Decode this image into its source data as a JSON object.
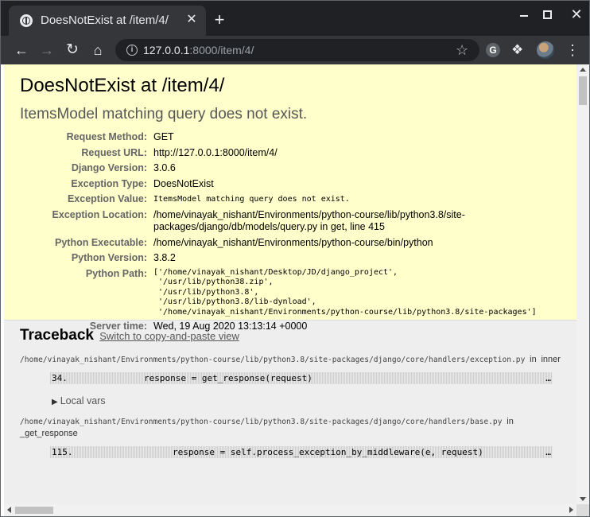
{
  "browser": {
    "tab_title": "DoesNotExist at /item/4/",
    "tab_close": "✕",
    "new_tab": "+",
    "url_host": "127.0.0.1",
    "url_path": ":8000/item/4/",
    "extension_g": "G",
    "icons": {
      "back": "arrow-left-icon",
      "forward": "arrow-right-icon",
      "reload": "reload-icon",
      "home": "home-icon",
      "star": "star-icon",
      "menu": "kebab-menu-icon"
    }
  },
  "error": {
    "title": "DoesNotExist at /item/4/",
    "exception_value": "ItemsModel matching query does not exist."
  },
  "meta": [
    {
      "label": "Request Method:",
      "value": "GET"
    },
    {
      "label": "Request URL:",
      "value": "http://127.0.0.1:8000/item/4/"
    },
    {
      "label": "Django Version:",
      "value": "3.0.6"
    },
    {
      "label": "Exception Type:",
      "value": "DoesNotExist"
    },
    {
      "label": "Exception Value:",
      "value": "ItemsModel matching query does not exist."
    },
    {
      "label": "Exception Location:",
      "value": "/home/vinayak_nishant/Environments/python-course/lib/python3.8/site-packages/django/db/models/query.py in get, line 415"
    },
    {
      "label": "Python Executable:",
      "value": "/home/vinayak_nishant/Environments/python-course/bin/python"
    },
    {
      "label": "Python Version:",
      "value": "3.8.2"
    },
    {
      "label": "Python Path:",
      "value": "['/home/vinayak_nishant/Desktop/JD/django_project',\n '/usr/lib/python38.zip',\n '/usr/lib/python3.8',\n '/usr/lib/python3.8/lib-dynload',\n '/home/vinayak_nishant/Environments/python-course/lib/python3.8/site-packages']"
    },
    {
      "label": "Server time:",
      "value": "Wed, 19 Aug 2020 13:13:14 +0000"
    }
  ],
  "traceback": {
    "heading": "Traceback",
    "switch_link": "Switch to copy-and-paste view",
    "frames": [
      {
        "file": "/home/vinayak_nishant/Environments/python-course/lib/python3.8/site-packages/django/core/handlers/exception.py",
        "in_word": "in",
        "function": "inner",
        "line_no": "34.",
        "code": "response = get_response(request)",
        "ellipsis": "…",
        "locals": "Local vars"
      },
      {
        "file": "/home/vinayak_nishant/Environments/python-course/lib/python3.8/site-packages/django/core/handlers/base.py",
        "in_word": "in",
        "function": "_get_response",
        "line_no": "115.",
        "code": "response = self.process_exception_by_middleware(e, request)",
        "ellipsis": "…"
      }
    ]
  }
}
